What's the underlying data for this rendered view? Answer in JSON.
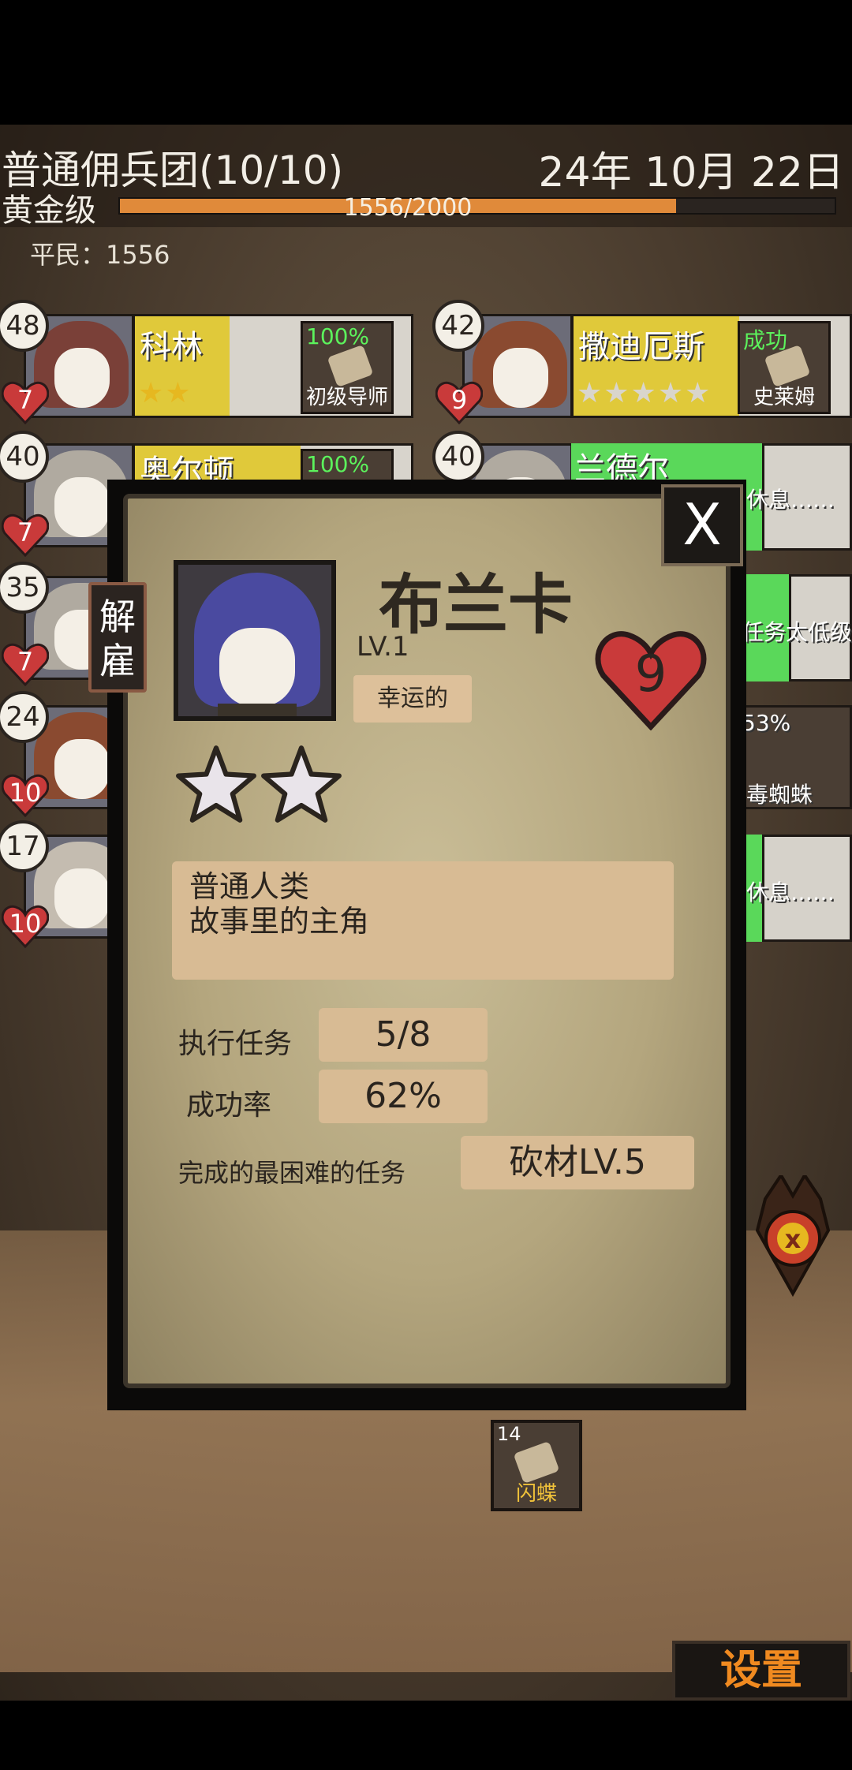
{
  "header": {
    "guild_name": "普通佣兵团(10/10)",
    "date": "24年 10月 22日",
    "rank": "黄金级",
    "xp_text": "1556/2000",
    "xp_progress": 0.778,
    "citizens": "平民：1556"
  },
  "roster": [
    {
      "level": "48",
      "hp": "7",
      "name": "科林",
      "stars": "★★",
      "task_pct": "100%",
      "task_name": "初级导师"
    },
    {
      "level": "42",
      "hp": "9",
      "name": "撒迪厄斯",
      "stars": "★★★★★",
      "task_pct": "成功",
      "task_name": "史莱姆"
    },
    {
      "level": "40",
      "hp": "7",
      "name": "奥尔顿",
      "task_pct": "100%"
    },
    {
      "level": "40",
      "name": "兰德尔"
    },
    {
      "level": "35",
      "hp": "7"
    },
    {
      "level": "24",
      "hp": "10"
    },
    {
      "level": "17",
      "hp": "10"
    }
  ],
  "side_partial": {
    "rest_1": "休息……",
    "too_low": "任务太低级",
    "pct": "53%",
    "spider": "毒蜘蛛",
    "rest_2": "休息……"
  },
  "dialog": {
    "close_label": "X",
    "dismiss_label": "解雇",
    "name": "布兰卡",
    "level": "LV.1",
    "trait": "幸运的",
    "hp": "9",
    "star_count": 2,
    "desc_line1": "普通人类",
    "desc_line2": "故事里的主角",
    "tasks_label": "执行任务",
    "tasks_value": "5/8",
    "success_label": "成功率",
    "success_value": "62%",
    "hardest_label": "完成的最困难的任务",
    "hardest_value": "砍材LV.5"
  },
  "task_token": {
    "count": "14",
    "name": "闪蝶"
  },
  "settings_label": "设置",
  "colors": {
    "accent": "#e08a3a",
    "gold": "#e0c93a",
    "heart": "#c93a3a",
    "green": "#5ad85a"
  }
}
